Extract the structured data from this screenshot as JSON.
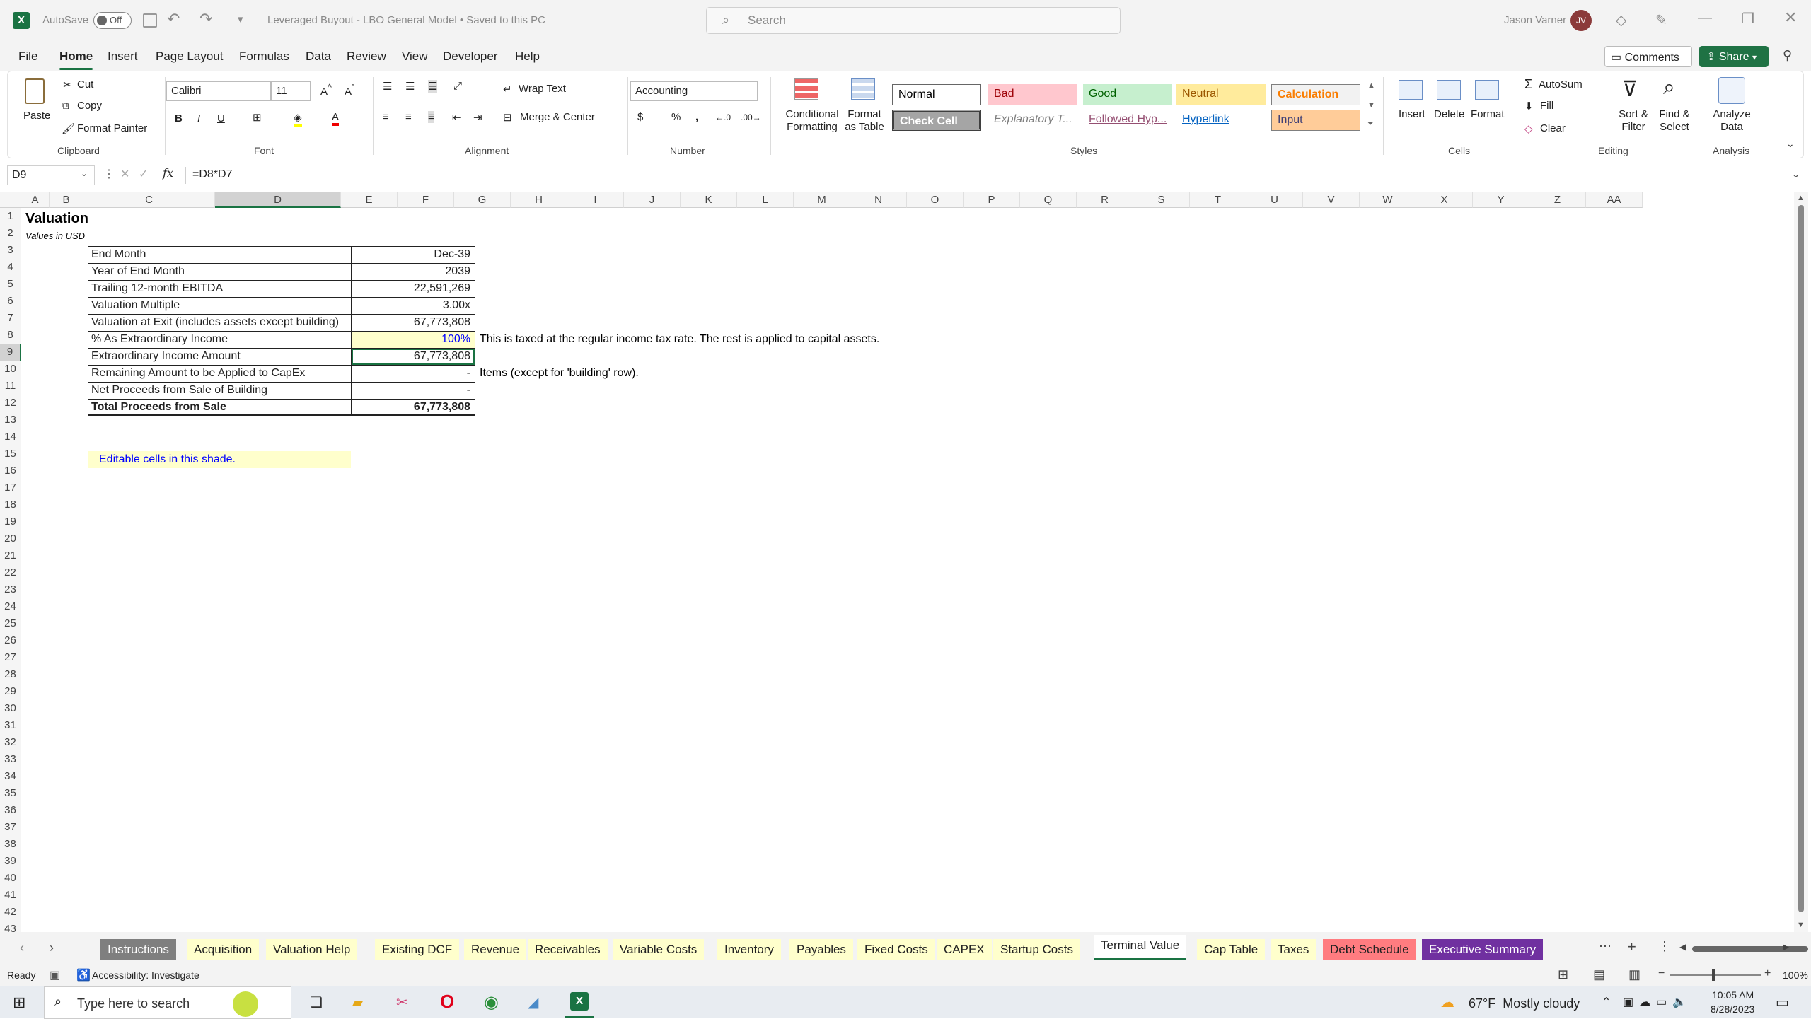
{
  "titlebar": {
    "autosave_label": "AutoSave",
    "autosave_state": "Off",
    "doc_title": "Leveraged Buyout - LBO General Model • Saved to this PC",
    "search_placeholder": "Search",
    "user_name": "Jason Varner",
    "user_initials": "JV"
  },
  "menu": {
    "tabs": [
      "File",
      "Home",
      "Insert",
      "Page Layout",
      "Formulas",
      "Data",
      "Review",
      "View",
      "Developer",
      "Help"
    ],
    "active": "Home",
    "comments_label": "Comments",
    "share_label": "Share"
  },
  "ribbon": {
    "clipboard": {
      "paste": "Paste",
      "cut": "Cut",
      "copy": "Copy",
      "format_painter": "Format Painter",
      "group": "Clipboard"
    },
    "font": {
      "name": "Calibri",
      "size": "11",
      "group": "Font"
    },
    "alignment": {
      "wrap_text": "Wrap Text",
      "merge_center": "Merge & Center",
      "group": "Alignment"
    },
    "number": {
      "format": "Accounting",
      "group": "Number"
    },
    "styles": {
      "conditional_formatting": "Conditional Formatting",
      "format_as_table": "Format as Table",
      "group": "Styles",
      "items": [
        "Normal",
        "Bad",
        "Good",
        "Neutral",
        "Calculation",
        "Check Cell",
        "Explanatory T...",
        "Followed Hyp...",
        "Hyperlink",
        "Input"
      ]
    },
    "cells": {
      "insert": "Insert",
      "delete": "Delete",
      "format": "Format",
      "group": "Cells"
    },
    "editing": {
      "autosum": "AutoSum",
      "fill": "Fill",
      "clear": "Clear",
      "sort_filter": "Sort & Filter",
      "find_select": "Find & Select",
      "group": "Editing"
    },
    "analysis": {
      "analyze_data": "Analyze Data",
      "group": "Analysis"
    }
  },
  "formula_bar": {
    "name_box": "D9",
    "formula": "=D8*D7"
  },
  "columns": [
    "A",
    "B",
    "C",
    "D",
    "E",
    "F",
    "G",
    "H",
    "I",
    "J",
    "K",
    "L",
    "M",
    "N",
    "O",
    "P",
    "Q",
    "R",
    "S",
    "T",
    "U",
    "V",
    "W",
    "X",
    "Y",
    "Z",
    "AA"
  ],
  "rows": [
    "1",
    "2",
    "3",
    "4",
    "5",
    "6",
    "7",
    "8",
    "9",
    "10",
    "11",
    "12",
    "13",
    "14",
    "15",
    "16",
    "17",
    "18",
    "19",
    "20",
    "21",
    "22",
    "23",
    "24",
    "25",
    "26",
    "27",
    "28",
    "29",
    "30",
    "31",
    "32",
    "33",
    "34",
    "35",
    "36",
    "37",
    "38",
    "39",
    "40",
    "41",
    "42",
    "43"
  ],
  "sheet": {
    "title": "Valuation",
    "subtitle": "Values in USD",
    "table": [
      {
        "label": "End Month",
        "value": "Dec-39"
      },
      {
        "label": "Year of End Month",
        "value": "2039"
      },
      {
        "label": "Trailing 12-month EBITDA",
        "value": "22,591,269"
      },
      {
        "label": "Valuation Multiple",
        "value": "3.00x"
      },
      {
        "label": "Valuation at Exit (includes assets except building)",
        "value": "67,773,808"
      },
      {
        "label": "% As Extraordinary Income",
        "value": "100%"
      },
      {
        "label": "Extraordinary Income Amount",
        "value": "67,773,808"
      },
      {
        "label": "Remaining Amount to be Applied to CapEx",
        "value": "-"
      },
      {
        "label": "Net Proceeds from Sale of Building",
        "value": "-"
      },
      {
        "label": "Total Proceeds from Sale",
        "value": "67,773,808"
      }
    ],
    "note_row8": "This is taxed at the regular income tax rate. The rest is applied to capital assets.",
    "note_row10": "Items (except for 'building' row).",
    "editable_note": "Editable cells in this shade.",
    "editable_color": "#ffffcc"
  },
  "sheet_tabs": [
    {
      "name": "Instructions",
      "bg": "#7f7f7f",
      "fg": "#ffffff"
    },
    {
      "name": "Acquisition",
      "bg": "#ffffcc",
      "fg": "#222222"
    },
    {
      "name": "Valuation Help",
      "bg": "#ffffcc",
      "fg": "#222222"
    },
    {
      "name": "Existing DCF",
      "bg": "#ffffcc",
      "fg": "#222222"
    },
    {
      "name": "Revenue",
      "bg": "#ffffcc",
      "fg": "#222222"
    },
    {
      "name": "Receivables",
      "bg": "#ffffcc",
      "fg": "#222222"
    },
    {
      "name": "Variable Costs",
      "bg": "#ffffcc",
      "fg": "#222222"
    },
    {
      "name": "Inventory",
      "bg": "#ffffcc",
      "fg": "#222222"
    },
    {
      "name": "Payables",
      "bg": "#ffffcc",
      "fg": "#222222"
    },
    {
      "name": "Fixed Costs",
      "bg": "#ffffcc",
      "fg": "#222222"
    },
    {
      "name": "CAPEX",
      "bg": "#ffffcc",
      "fg": "#222222"
    },
    {
      "name": "Startup Costs",
      "bg": "#ffffcc",
      "fg": "#222222"
    },
    {
      "name": "Terminal Value",
      "bg": "#ffffff",
      "fg": "#222222"
    },
    {
      "name": "Cap Table",
      "bg": "#ffffcc",
      "fg": "#222222"
    },
    {
      "name": "Taxes",
      "bg": "#ffffcc",
      "fg": "#222222"
    },
    {
      "name": "Debt Schedule",
      "bg": "#ff7c80",
      "fg": "#222222"
    },
    {
      "name": "Executive Summary",
      "bg": "#7030a0",
      "fg": "#ffffff"
    }
  ],
  "active_sheet": "Terminal Value",
  "status": {
    "ready": "Ready",
    "accessibility": "Accessibility: Investigate",
    "zoom": "100%"
  },
  "taskbar": {
    "search_placeholder": "Type here to search",
    "weather": "67°F  Mostly cloudy",
    "time": "10:05 AM",
    "date": "8/28/2023"
  },
  "colors": {
    "excel_green": "#1a7343",
    "share_green": "#1f7244",
    "input_blue": "#0000ff"
  }
}
